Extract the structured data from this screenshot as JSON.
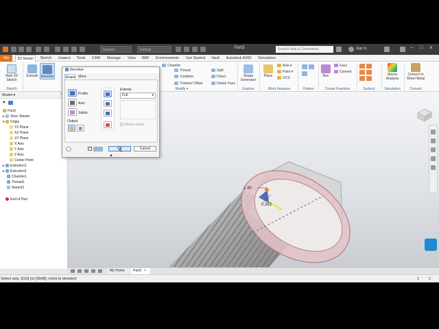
{
  "app": {
    "title": "Part3",
    "search_placeholder": "Search Help & Commands...",
    "sign_in": "Sign In",
    "material": "Generic",
    "appearance": "Default"
  },
  "tabs": [
    "File",
    "3D Model",
    "Sketch",
    "Inspect",
    "Tools",
    "CAM",
    "Manage",
    "View",
    "BIM",
    "Environments",
    "Get Started",
    "Vault",
    "Autodesk A360",
    "Simulation"
  ],
  "ribbon": {
    "start_sketch": "Start 2D Sketch",
    "sketch_panel": "Sketch",
    "extrude": "Extrude",
    "revolve": "Revolve",
    "small_col1": [
      "Chamfer",
      "Thread",
      "Combine",
      "Thicken/ Offset"
    ],
    "small_col2": [
      "Split",
      "Direct",
      "Delete Face"
    ],
    "modify_panel": "Modify ▾",
    "shape_generator": "Shape Generator",
    "explore_panel": "Explore",
    "plane": "Plane",
    "axis": "Axis ▾",
    "point": "Point ▾",
    "ucs": "UCS",
    "work_features_panel": "Work Features",
    "pattern_panel": "Pattern",
    "box": "Box",
    "face": "Face",
    "convert": "Convert",
    "freeform_panel": "Create Freeform",
    "surface_panel": "Surface",
    "stress_analysis": "Stress Analysis",
    "simulation_panel": "Simulation",
    "convert_sheet": "Convert to Sheet Metal",
    "convert_panel": "Convert"
  },
  "browser": {
    "header": "Model ▾",
    "items": [
      "Part3",
      "View: Master",
      "Origin",
      "YZ Plane",
      "XZ Plane",
      "XY Plane",
      "X Axis",
      "Y Axis",
      "Z Axis",
      "Center Point",
      "Extrusion1",
      "Extrusion2",
      "Chamfer1",
      "Thread1",
      "Sketch3",
      "End of Part"
    ]
  },
  "dialog": {
    "title": "Revolve",
    "tab_shape": "Shape",
    "tab_more": "More",
    "profile": "Profile",
    "axis": "Axis",
    "solids": "Solids",
    "output": "Output",
    "extents": "Extents",
    "extents_value": "Full",
    "match_shape": "Match shape",
    "ok": "OK",
    "cancel": "Cancel"
  },
  "viewport": {
    "dim1": "1.40",
    "dim2": "0.393"
  },
  "doc_tabs": [
    "My Home",
    "Part3"
  ],
  "status": {
    "message": "Select axis. [Ctrl] (or [Shift]) +click to deselect",
    "count1": "1",
    "count2": "1"
  }
}
